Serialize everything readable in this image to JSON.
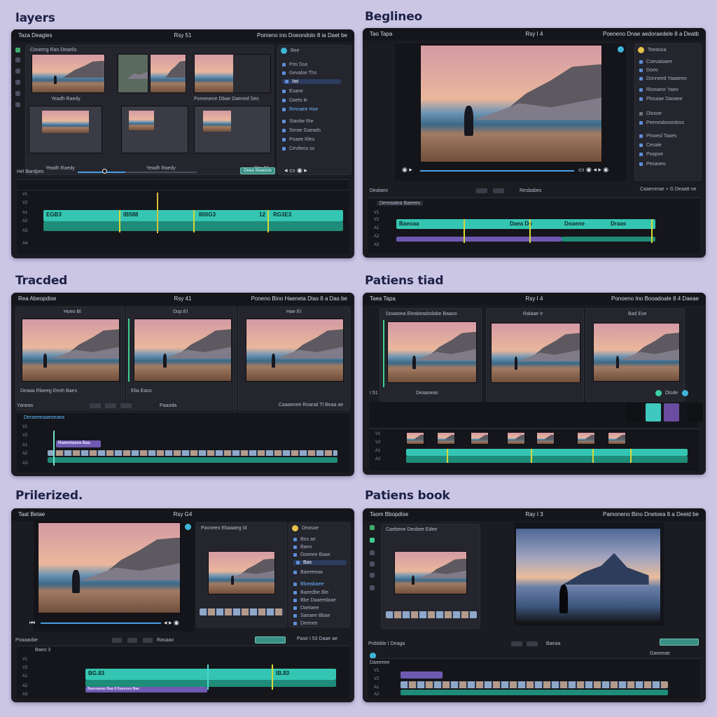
{
  "captions": [
    "layers",
    "Beglineo",
    "Tracded",
    "Patiens tiad",
    "Prilerized.",
    "Patiens book"
  ],
  "panels": [
    {
      "title_left": "Taza Deagies",
      "title_center": "Rsy 51",
      "title_right": "Pomeno ino Doeondolo 8 ia Daet be",
      "media_labels": [
        "Conemg Ran Deaelis",
        "Yeadh Raedy",
        "Pomesene Dbae Daened Ses"
      ],
      "sidebar": [
        "Bee",
        "Pmi Ssa",
        "Gevalse Ths",
        "Ias",
        "Esane",
        "Daeto le",
        "Rmnaee Hoe",
        "Stanbe Rie",
        "Serae Gaeads",
        "Pnaee Rles",
        "Cevtleos ss"
      ],
      "timeline_label": "Hel Bardpes",
      "clips": [
        "EGB3",
        "IB588",
        "800G3",
        "RG3E3"
      ],
      "marker": "12",
      "action": "Deea Seaesce"
    },
    {
      "title_left": "Tao Tapa",
      "title_center": "Rsy I 4",
      "title_right": "Poeneno Dnae aedoraedele 8 a Deatb",
      "sidebar_header": "Toeasoa",
      "sidebar": [
        "Coevaisaee",
        "Doeo",
        "Donneed Yaaaeeo",
        "Rlonaesr Yaeo",
        "Plosaae Daoaee",
        "Dlosoe",
        "Peeneabosedoss",
        "Pinoesl Taaes",
        "Cesaie",
        "Poapoe",
        "Pesaoeo"
      ],
      "timeline_label": "Dealaeo",
      "timeline_right": "Caaenerae + G Deaatt ne",
      "playback_label": "Resbabes",
      "track_tag": "Dereaatea Baeees",
      "clips": [
        "Baeoaa",
        "Daea Dn",
        "Doaene",
        "Draas"
      ]
    },
    {
      "title_left": "Rea Abeopdise",
      "title_center": "Rsy 41",
      "title_right": "Poneno Bino Haeneta Dias 8 a Das be",
      "cams": [
        "Hoeo Bl",
        "Dop El",
        "Hae El"
      ],
      "cam_labels": [
        "Deaaa Rlaeeg Eeoh Baes",
        "Elia Eaos"
      ],
      "timeline_label": "Yaneas",
      "timeline_right": "Caaaenee Roanal Tl Beaa ae",
      "center_label": "Paaoda",
      "track_tag": "Deraeeeaaeoeaea",
      "clip": "Raeeetaeea Baa"
    },
    {
      "title_left": "Taea Tapa",
      "title_center": "Rsy I 4",
      "title_right": "Ponoeno Ino Booadoale 8 4 Daeae",
      "cams": [
        "Doaaoea Eleabeadodabe Baaoo",
        "Ralaae Ir",
        "Bad Ese"
      ],
      "timecode": "I 51",
      "timeline_label": "Deaaoeas",
      "right_label": "Dlode",
      "swatches": [
        "#101114",
        "#3ec8c0",
        "#6a4da0",
        "#101114"
      ]
    },
    {
      "title_left": "Taat Betae",
      "title_center": "Rsy G4",
      "title_right": "Panesee Dlto Dtes M",
      "sidebar_header": "Deasae",
      "sidebar": [
        "Bos ae",
        "Baeo",
        "Doeeee Baae",
        "Bas",
        "Baeeeeaa",
        "Bloeabaee",
        "Baeedbe Ble",
        "Bbe Daaeedaae",
        "Daetaee",
        "Saeaee Bbae",
        "Deenee"
      ],
      "preview_label": "Pavoeeo Ebaaaeg Id",
      "timeline_label": "Pnaaaobe",
      "center_label": "Rasaao",
      "right_label": "Pase I 53 Daae ae",
      "clips": [
        "BG.83",
        "IB.83"
      ],
      "track_tag": "Baeo 3",
      "purple_clip": "Baeeeaeao Baa 8 Daoeoeo Bae"
    },
    {
      "title_left": "Taom Bbopdise",
      "title_center": "Ray I 3",
      "title_right": "Pamoneno Bino Dnetoea 8 a Deeid be",
      "media_label": "Caebene Deobee Edee",
      "timeline_label": "Pnbbble I Deaga",
      "center_label": "Baeaa",
      "right_label": "Gaeeeae",
      "track_tag": "Daeeeee"
    }
  ]
}
